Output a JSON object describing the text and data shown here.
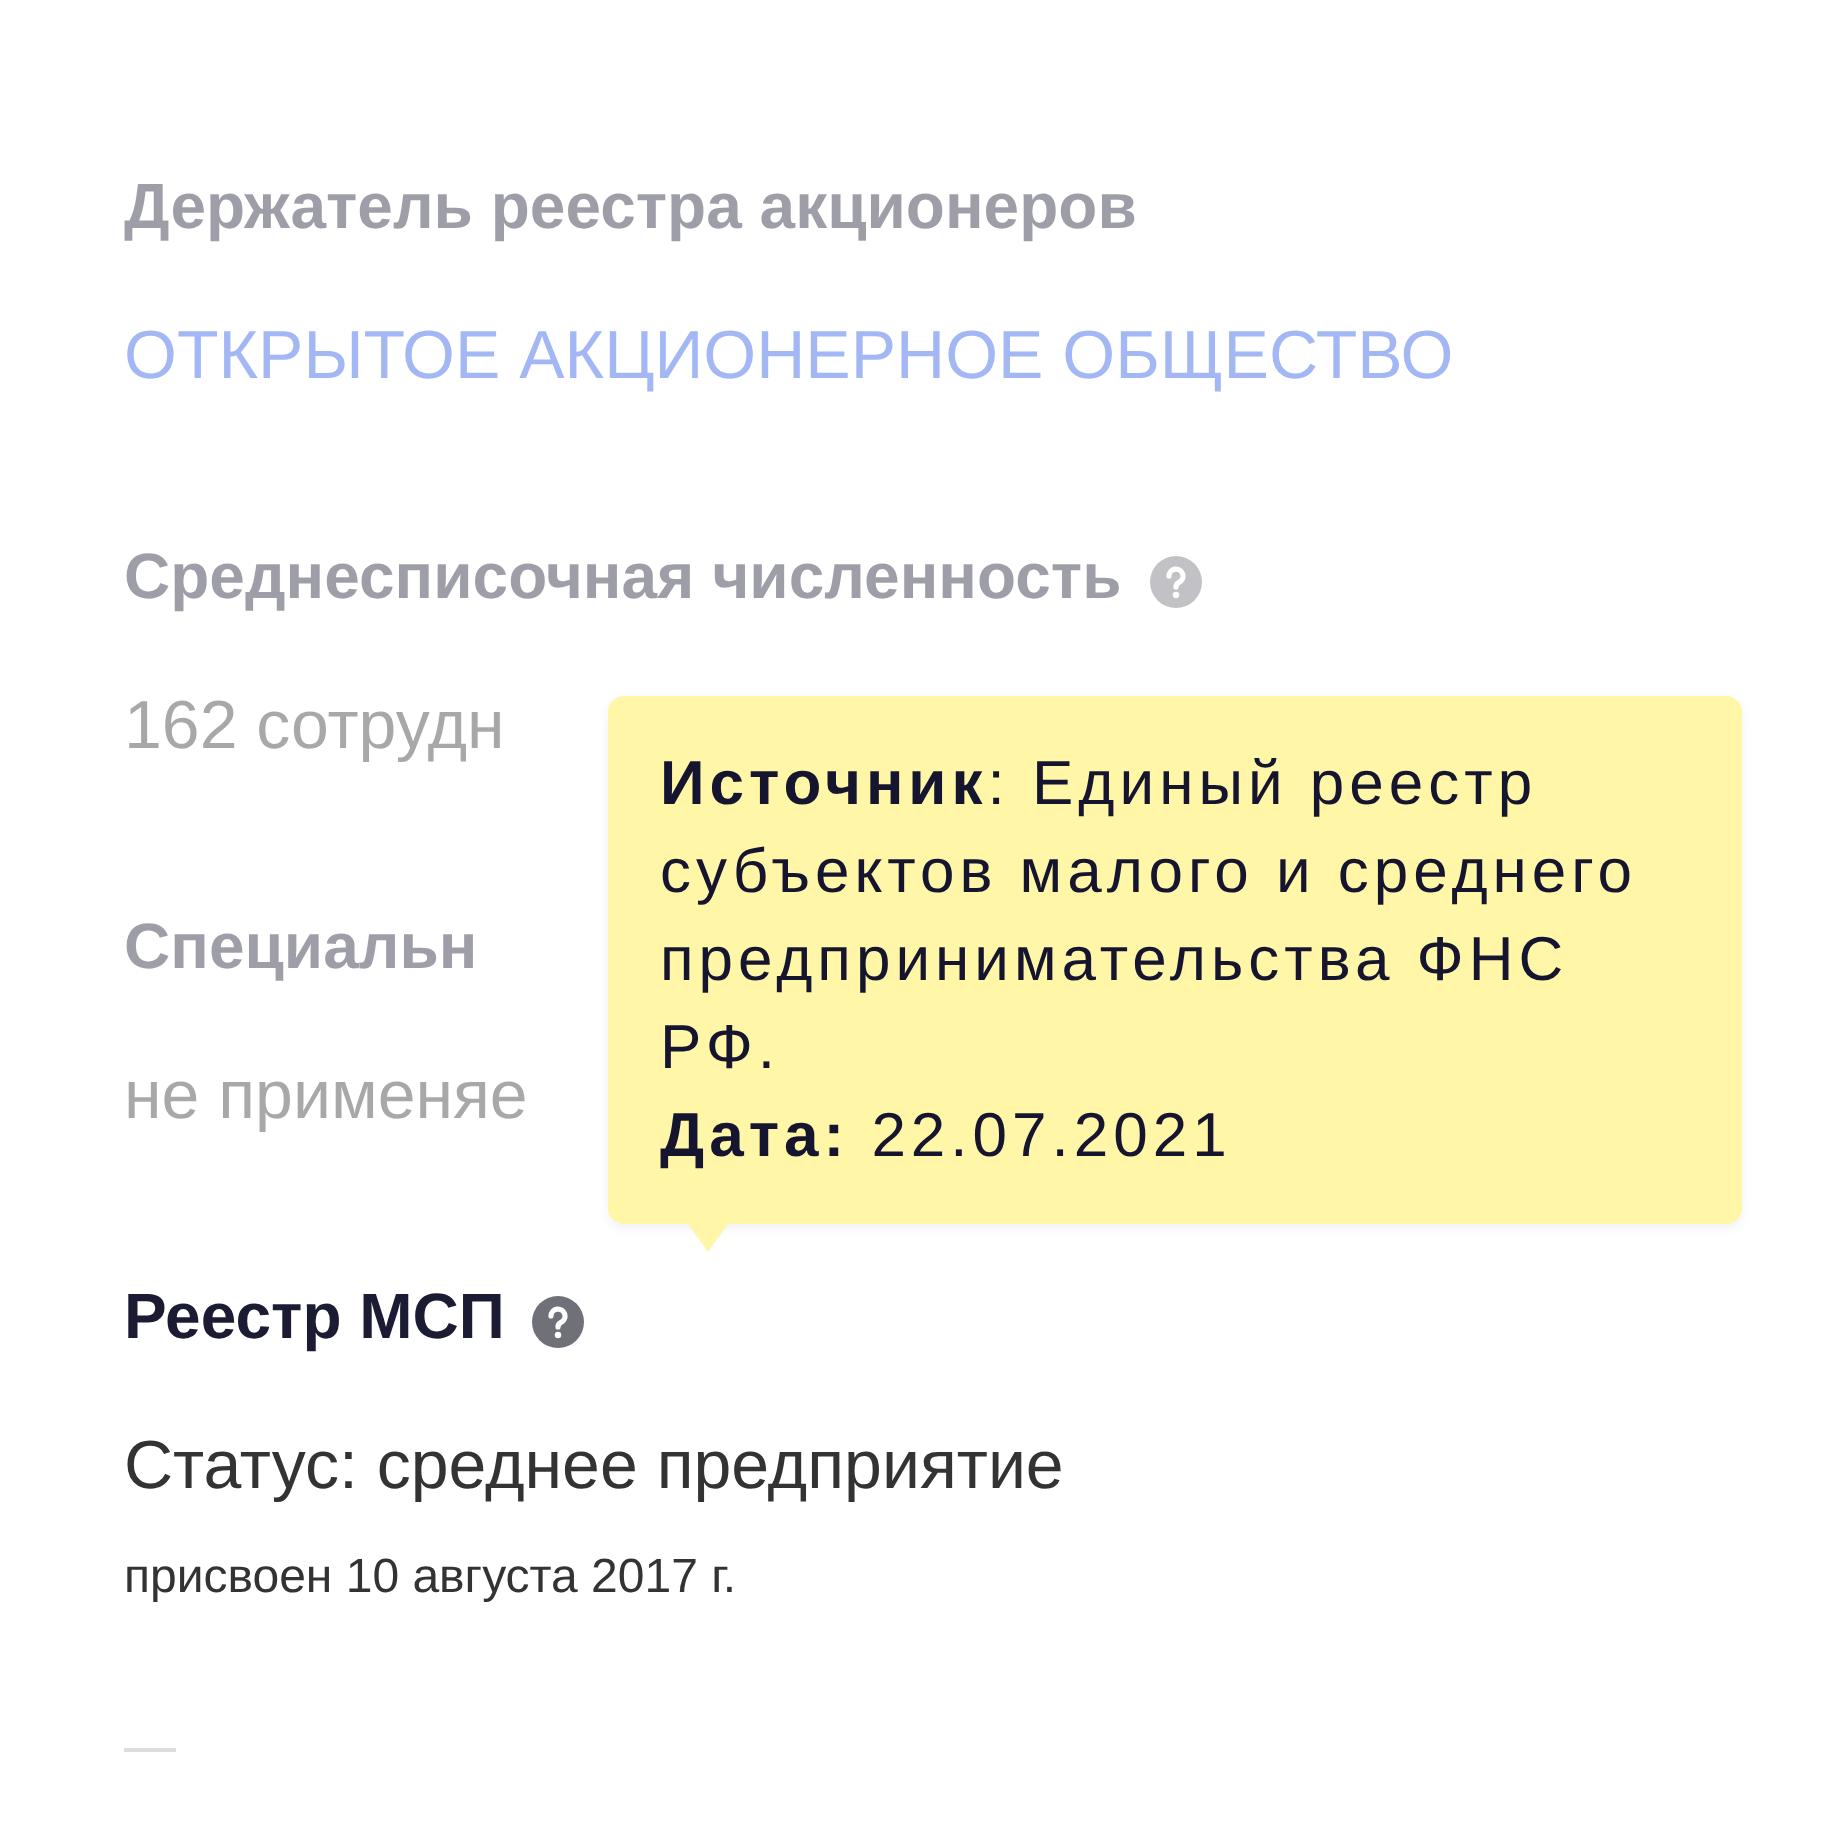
{
  "sections": [
    {
      "kind": "link",
      "dimmed": true,
      "title": "Держатель реестра акционеров",
      "help": false,
      "value": "ОТКРЫТОЕ АКЦИОНЕРНОЕ ОБЩЕСТВО"
    },
    {
      "kind": "text",
      "dimmed": true,
      "title": "Среднесписочная численность",
      "help": true,
      "value": "162 сотрудн"
    },
    {
      "kind": "text",
      "dimmed": true,
      "title": "Специальн",
      "help": false,
      "value": "не применяе"
    },
    {
      "kind": "status",
      "dimmed": false,
      "title": "Реестр МСП",
      "help": true,
      "value": "Статус: среднее предприятие",
      "note": "присвоен 10 августа 2017 г."
    }
  ],
  "tooltip": {
    "source": "**Источник**: Единый реестр субъектов малого и среднего предпринимательства ФНС РФ.",
    "date": "**Дата:** 22.07.2021"
  }
}
